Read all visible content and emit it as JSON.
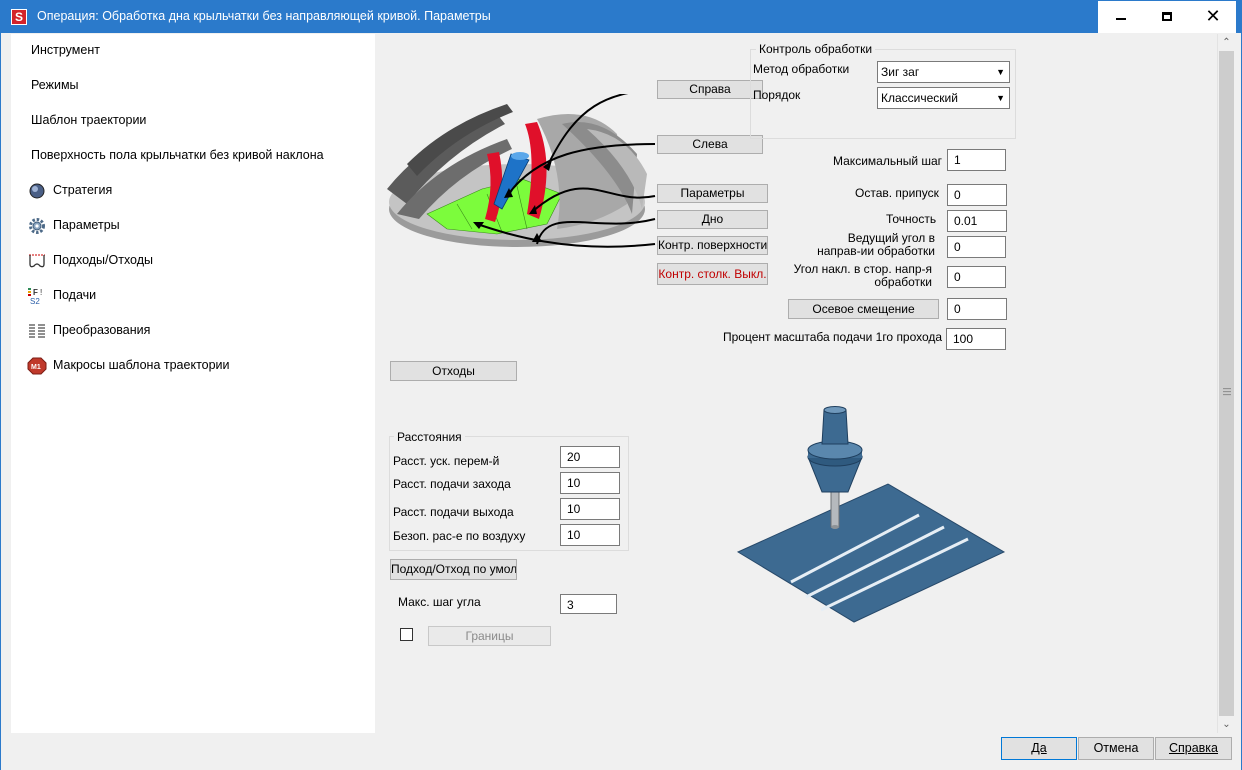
{
  "window": {
    "title": "Операция: Обработка дна крыльчатки без направляющей кривой. Параметры",
    "app_icon_letter": "S"
  },
  "sidebar": {
    "items": [
      {
        "label": "Инструмент",
        "icon": ""
      },
      {
        "label": "Режимы",
        "icon": ""
      },
      {
        "label": "Шаблон траектории",
        "icon": ""
      },
      {
        "label": "Поверхность пола крыльчатки без кривой наклона",
        "icon": ""
      },
      {
        "label": "Стратегия",
        "icon": "strategy-sphere-icon"
      },
      {
        "label": "Параметры",
        "icon": "gear-icon"
      },
      {
        "label": "Подходы/Отходы",
        "icon": "approach-retract-icon"
      },
      {
        "label": "Подачи",
        "icon": "feeds-icon"
      },
      {
        "label": "Преобразования",
        "icon": "transform-icon"
      },
      {
        "label": "Макросы шаблона траектории",
        "icon": "macros-icon"
      }
    ]
  },
  "diagram_buttons": {
    "right": "Справа",
    "left": "Слева",
    "params": "Параметры",
    "bottom": "Дно",
    "check_surfaces": "Контр. поверхности",
    "check_collision": "Контр. столк. Выкл."
  },
  "machining_control": {
    "title": "Контроль обработки",
    "method_label": "Метод обработки",
    "method_value": "Зиг заг",
    "order_label": "Порядок",
    "order_value": "Классический"
  },
  "params": {
    "max_step_label": "Максимальный шаг",
    "max_step_value": "1",
    "stock_label": "Остав. припуск",
    "stock_value": "0",
    "tolerance_label": "Точность",
    "tolerance_value": "0.01",
    "lead_angle_label_1": "Ведущий угол в",
    "lead_angle_label_2": "направ-ии обработки",
    "lead_angle_value": "0",
    "tilt_angle_label_1": "Угол накл. в стор. напр-я",
    "tilt_angle_label_2": "обработки",
    "tilt_angle_value": "0",
    "axial_offset_button": "Осевое смещение",
    "axial_offset_value": "0",
    "feed_scale_label": "Процент масштаба подачи 1го прохода",
    "feed_scale_value": "100"
  },
  "retracts_button": "Отходы",
  "distances": {
    "title": "Расстояния",
    "rapid_label": "Расст. уск. перем-й",
    "rapid_value": "20",
    "approach_label": "Расст. подачи захода",
    "approach_value": "10",
    "exit_label": "Расст. подачи выхода",
    "exit_value": "10",
    "air_label": "Безоп. рас-е по воздуху",
    "air_value": "10"
  },
  "default_approach_button": "Подход/Отход по умолч.",
  "max_angle_step_label": "Макс. шаг угла",
  "max_angle_step_value": "3",
  "boundaries_button": "Границы",
  "dialog_buttons": {
    "ok": "Да",
    "cancel": "Отмена",
    "help": "Справка"
  },
  "colors": {
    "title_bar": "#2b7acb",
    "floor_green": "#7cfc3c",
    "blade_red": "#e0102a",
    "tool_blue": "#1e73c8",
    "plate_blue": "#3d6a91"
  }
}
